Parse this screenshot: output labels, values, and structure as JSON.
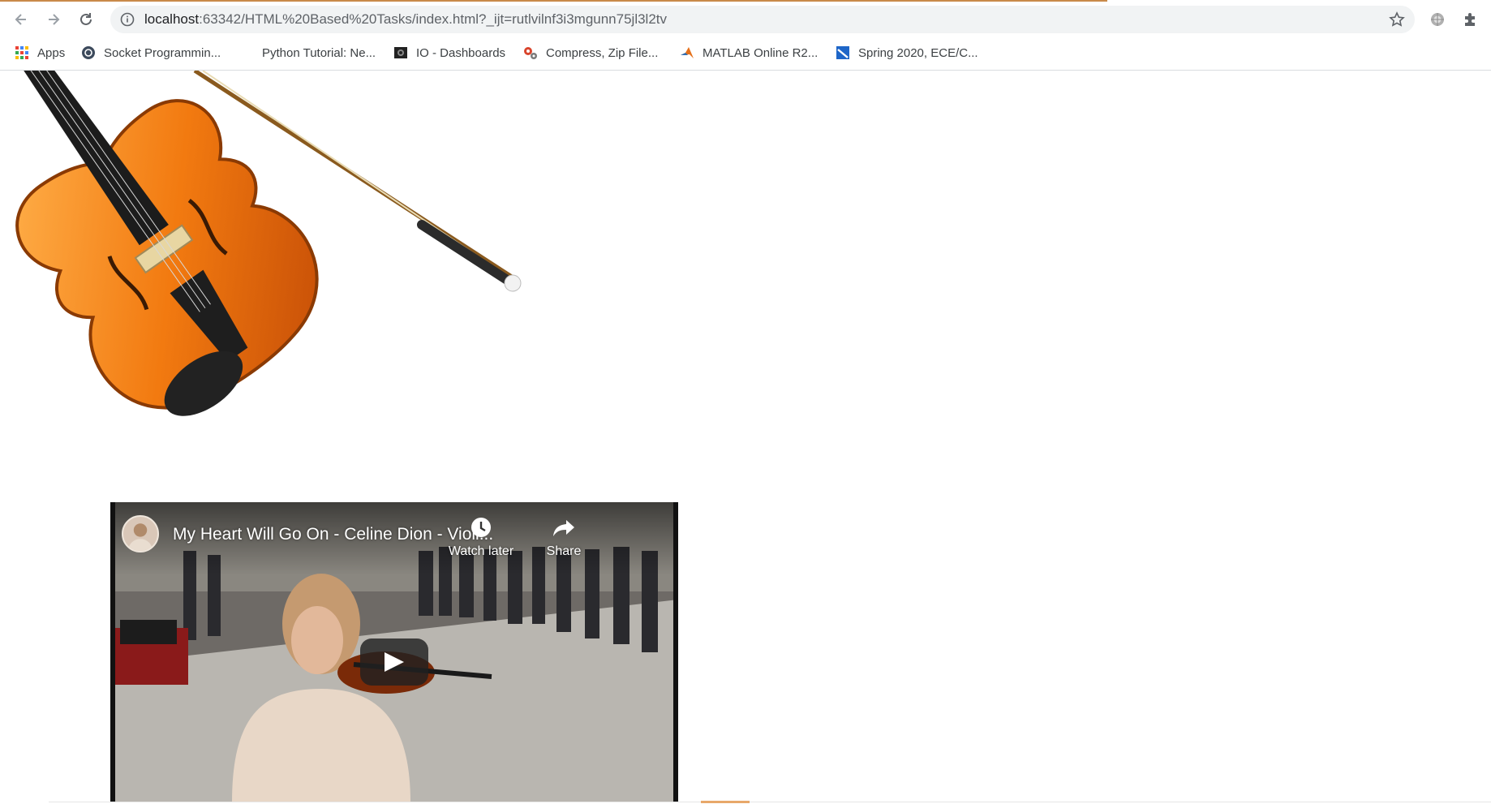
{
  "browser": {
    "url_host": "localhost",
    "url_rest": ":63342/HTML%20Based%20Tasks/index.html?_ijt=rutlvilnf3i3mgunn75jl3l2tv",
    "bookmarks": [
      {
        "label": "Apps",
        "icon": "apps-grid-icon"
      },
      {
        "label": "Socket Programmin...",
        "icon": "python-icon"
      },
      {
        "label": "Python Tutorial: Ne...",
        "icon": "blank-icon"
      },
      {
        "label": "IO - Dashboards",
        "icon": "dashboard-icon"
      },
      {
        "label": "Compress, Zip File...",
        "icon": "gears-icon"
      },
      {
        "label": "MATLAB Online R2...",
        "icon": "matlab-icon"
      },
      {
        "label": "Spring 2020, ECE/C...",
        "icon": "canvas-icon"
      }
    ]
  },
  "video": {
    "title": "My Heart Will Go On - Celine Dion - Violi...",
    "watch_later": "Watch later",
    "share": "Share"
  },
  "colors": {
    "accent": "#c98a4a",
    "violin": "#f07a12"
  }
}
